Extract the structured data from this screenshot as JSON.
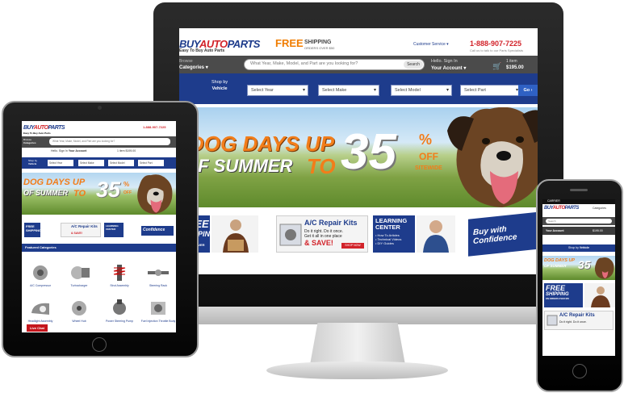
{
  "desktop": {
    "logo_a": "BUY",
    "logo_b": "AUTO",
    "logo_c": "PARTS",
    "tagline": "Easy To Buy Auto Parts",
    "free": "FREE",
    "shipping": "SHIPPING",
    "shipping_sub": "ORDERS OVER $50",
    "customer_service": "Customer Service",
    "phone": "1-888-907-7225",
    "phone_sub": "Call us to talk to our Parts Specialists",
    "browse": "Browse",
    "categories": "Categories",
    "search_placeholder": "What Year, Make, Model, and Part are you looking for?",
    "search_button": "Search",
    "hello": "Hello. Sign In",
    "your_account": "Your Account",
    "cart_items": "1 item",
    "cart_price": "$195.00",
    "shop_by": "Shop by",
    "vehicle": "Vehicle",
    "selects": [
      "Select Year",
      "Select Make",
      "Select Model",
      "Select Part"
    ],
    "go": "Go ›",
    "banner_line1": "DOG DAYS UP",
    "banner_line2": "OF SUMMER",
    "banner_to": "TO",
    "banner_35": "35",
    "banner_pct": "%",
    "banner_off": "OFF",
    "banner_site": "SITEWIDE",
    "tile_free_1": "FREE",
    "tile_free_2": "SHIPPING",
    "tile_free_sub": "ORDERS OVER $50",
    "ac_title": "A/C Repair Kits",
    "ac_line1": "Do it right. Do it once.",
    "ac_line2": "Get it all in one place",
    "ac_save": "& SAVE!",
    "ac_shop": "SHOP NOW",
    "learn_1": "LEARNING",
    "learn_2": "CENTER",
    "learn_list": [
      "• How To Articles",
      "• Technical Videos",
      "• DIY Guides"
    ],
    "confidence": "Buy with Confidence"
  },
  "tablet": {
    "phone": "1-888-907-7225",
    "search_placeholder": "What Year, Make, Model, and Part are you looking for?",
    "hello": "Hello. Sign In",
    "your_account": "Your Account",
    "cart": "1 item $195.00",
    "shop_by": "Shop by",
    "vehicle": "Vehicle",
    "selects": [
      "Select Year",
      "Select Make",
      "Select Model",
      "Select Part"
    ],
    "featured": "Featured Categories",
    "cats": [
      "A/C Compressor",
      "Turbocharger",
      "Strut Assembly",
      "Steering Rack",
      "Headlight Assembly",
      "Wheel Hub",
      "Power Steering Pump",
      "Fuel Injection Throttle Body"
    ],
    "live_chat": "Live Chat",
    "confidence": "Confidence"
  },
  "phone": {
    "carrier": "CARRIER",
    "search": "Search",
    "your_account": "Your Account",
    "shop_by": "Shop by",
    "vehicle": "Vehicle",
    "free": "FREE",
    "shipping": "SHIPPING",
    "shipping_sub": "ON ORDERS OVER $50",
    "ac_title": "A/C Repair Kits",
    "ac_line": "Do it right. Do it once.",
    "price": "$195.00"
  },
  "colors": {
    "brand_blue": "#1e3c8c",
    "brand_red": "#d2232a",
    "orange": "#f27d1a",
    "dark_bar": "#4b4b4b"
  }
}
